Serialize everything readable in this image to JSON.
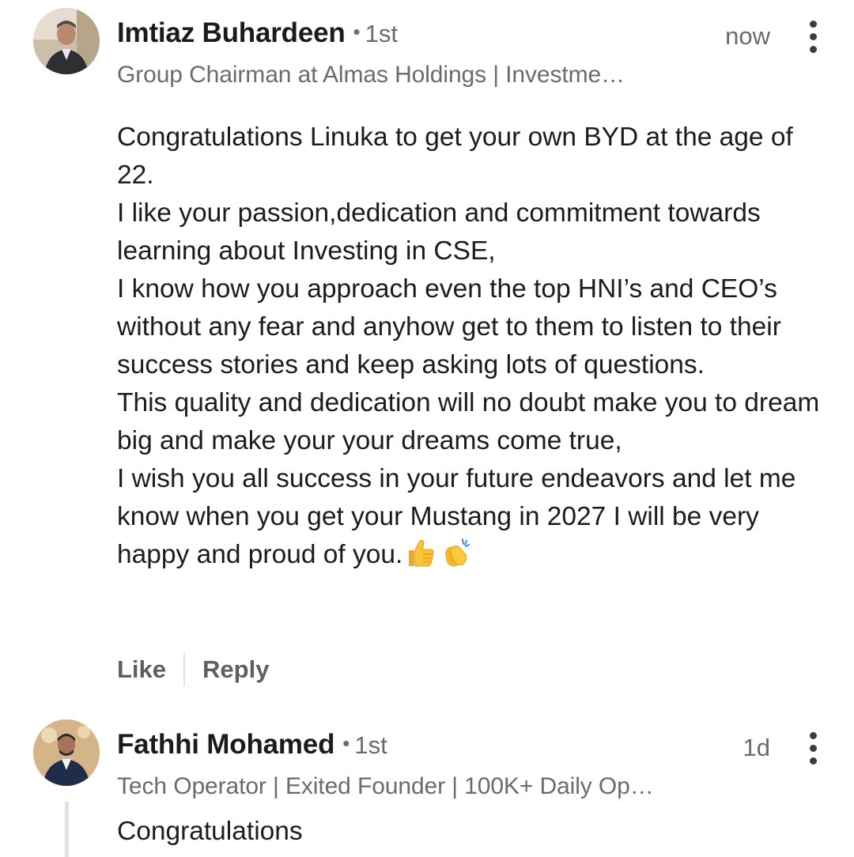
{
  "comments": [
    {
      "author": "Imtiaz Buhardeen",
      "degree": "1st",
      "separator": "•",
      "headline": "Group Chairman at Almas Holdings | Investme…",
      "time": "now",
      "text": "Congratulations Linuka to get your own BYD at the age of 22.\nI like your passion,dedication and commitment towards learning about Investing in CSE,\nI know how you approach even the top HNI’s and CEO’s without any fear and anyhow get to them to listen to their success stories and keep asking lots of questions.\nThis quality and dedication will no doubt make you to dream big and make your your dreams come true,\nI wish you all success in your future endeavors and let me know when you get your Mustang in 2027 I will be very happy and proud of you.",
      "emojis": [
        "thumbs-up-icon",
        "clapping-hands-icon"
      ],
      "actions": {
        "like": "Like",
        "reply": "Reply"
      }
    },
    {
      "author": "Fathhi Mohamed",
      "degree": "1st",
      "separator": "•",
      "headline": "Tech Operator | Exited Founder | 100K+ Daily Op…",
      "time": "1d",
      "text": "Congratulations"
    }
  ],
  "colors": {
    "name": "#1b1b1b",
    "secondary": "#6b6b6b",
    "body": "#1c1c1c",
    "action": "#5f5f5f",
    "divider": "#e2e2e2"
  }
}
